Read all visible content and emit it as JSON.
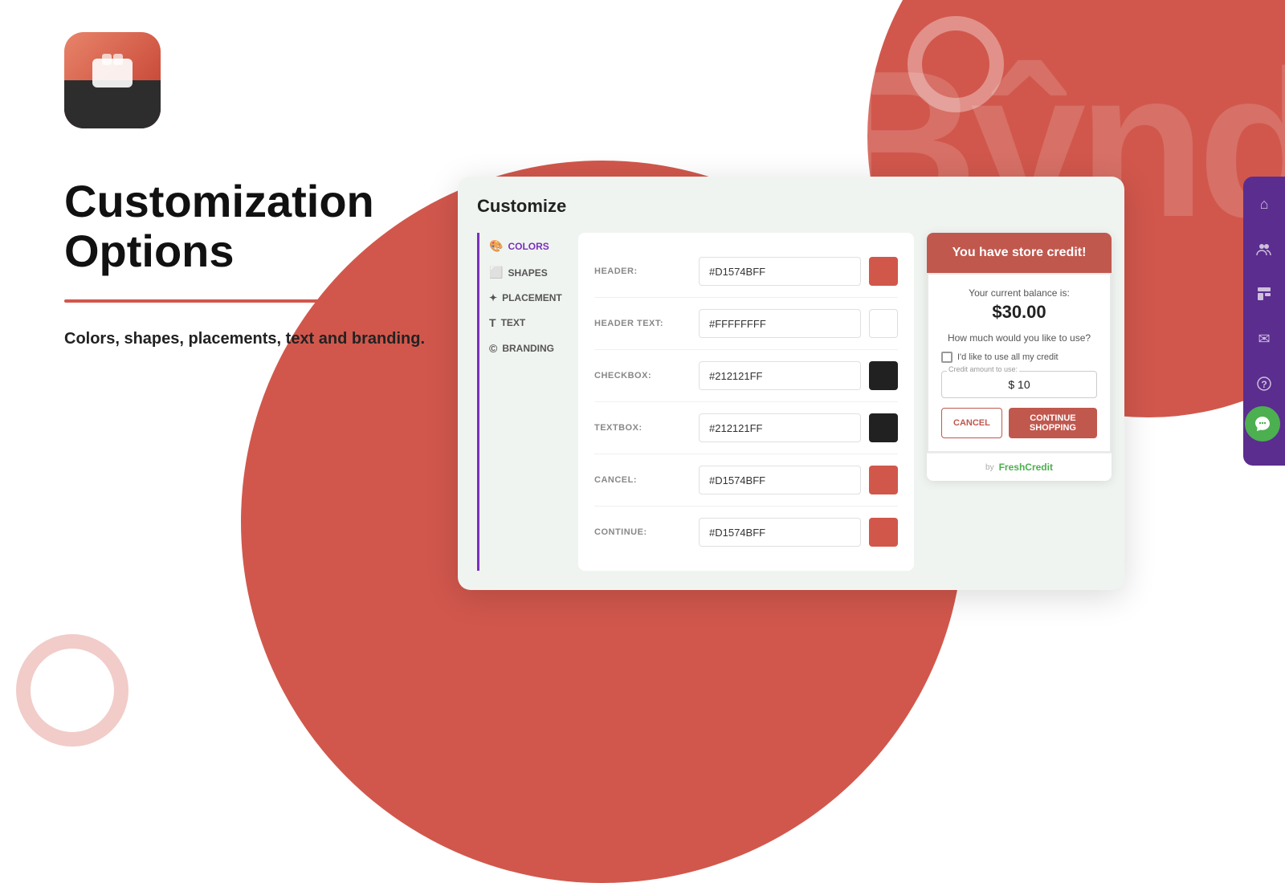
{
  "page": {
    "bg_color_primary": "#D1574C",
    "bg_color_secondary": "#fff"
  },
  "logo": {
    "alt": "App Logo"
  },
  "left": {
    "main_title_line1": "Customization",
    "main_title_line2": "Options",
    "subtitle": "Colors, shapes, placements, text and branding."
  },
  "panel": {
    "title": "Customize",
    "sidebar": {
      "items": [
        {
          "id": "colors",
          "label": "COLORS",
          "icon": "🎨",
          "active": true
        },
        {
          "id": "shapes",
          "label": "SHAPES",
          "icon": "⬜"
        },
        {
          "id": "placement",
          "label": "PLACEMENT",
          "icon": "✦"
        },
        {
          "id": "text",
          "label": "TEXT",
          "icon": "T"
        },
        {
          "id": "branding",
          "label": "BRANDING",
          "icon": "©"
        }
      ]
    },
    "color_rows": [
      {
        "id": "header",
        "label": "HEADER:",
        "value": "#D1574BFF",
        "swatch": "#D1574B"
      },
      {
        "id": "header_text",
        "label": "HEADER TEXT:",
        "value": "#FFFFFFFF",
        "swatch": "#FFFFFF"
      },
      {
        "id": "checkbox",
        "label": "CHECKBOX:",
        "value": "#212121FF",
        "swatch": "#212121"
      },
      {
        "id": "textbox",
        "label": "TEXTBOX:",
        "value": "#212121FF",
        "swatch": "#212121"
      },
      {
        "id": "cancel",
        "label": "CANCEL:",
        "value": "#D1574BFF",
        "swatch": "#D1574B"
      },
      {
        "id": "continue",
        "label": "CONTINUE:",
        "value": "#D1574BFF",
        "swatch": "#D1574B"
      }
    ]
  },
  "preview": {
    "card_header": "You have store credit!",
    "balance_label": "Your current balance is:",
    "balance": "$30.00",
    "use_question": "How much would you like to use?",
    "checkbox_label": "I'd like to use all my credit",
    "amount_field_label": "Credit amount to use:",
    "amount_value": "$ 10",
    "btn_cancel": "CANCEL",
    "btn_continue": "CONTINUE SHOPPING",
    "powered_by": "by",
    "logo_text": "FreshCredit"
  },
  "right_sidebar": {
    "icons": [
      {
        "id": "home",
        "symbol": "⌂"
      },
      {
        "id": "users",
        "symbol": "👥"
      },
      {
        "id": "template",
        "symbol": "▦"
      },
      {
        "id": "mail",
        "symbol": "✉"
      },
      {
        "id": "help",
        "symbol": "?"
      }
    ],
    "chat_icon": "💬"
  }
}
